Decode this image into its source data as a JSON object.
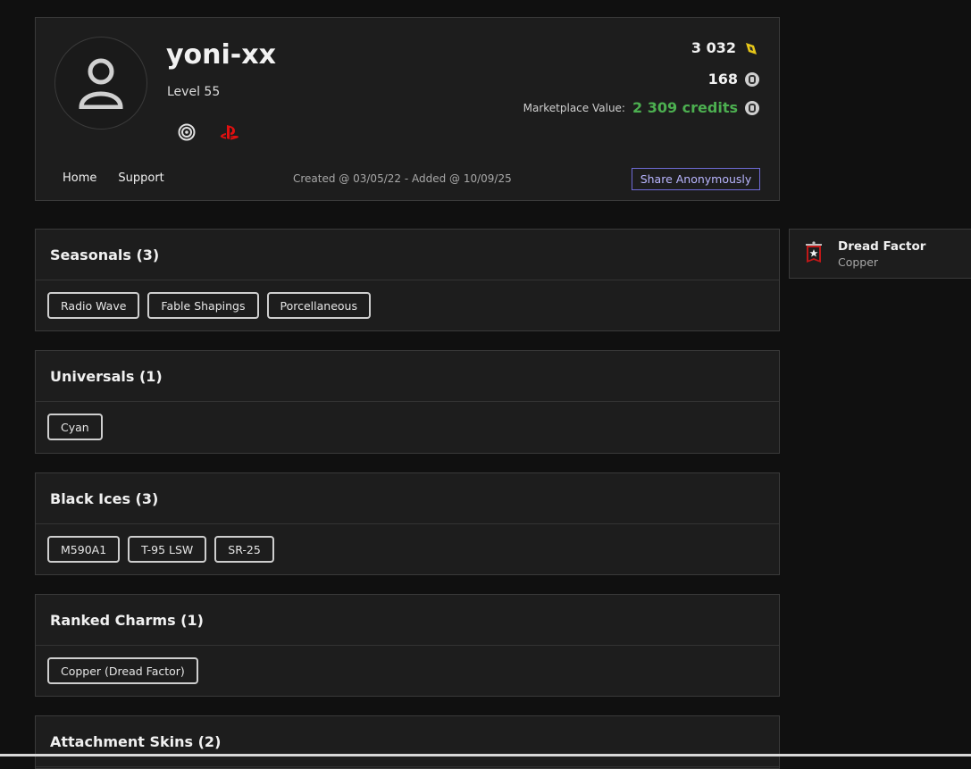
{
  "profile": {
    "username": "yoni-xx",
    "level": "Level 55",
    "renown": "3 032",
    "credits": "168",
    "marketplace_label": "Marketplace Value:",
    "marketplace_value": "2 309 credits",
    "platforms": [
      "ubisoft-icon",
      "playstation-icon"
    ],
    "nav": {
      "home": "Home",
      "support": "Support"
    },
    "created": "Created @ 03/05/22 - Added @ 10/09/25",
    "share_label": "Share Anonymously"
  },
  "sections": [
    {
      "title": "Seasonals (3)",
      "items": [
        "Radio Wave",
        "Fable Shapings",
        "Porcellaneous"
      ]
    },
    {
      "title": "Universals (1)",
      "items": [
        "Cyan"
      ]
    },
    {
      "title": "Black Ices (3)",
      "items": [
        "M590A1",
        "T-95 LSW",
        "SR-25"
      ]
    },
    {
      "title": "Ranked Charms (1)",
      "items": [
        "Copper (Dread Factor)"
      ]
    },
    {
      "title": "Attachment Skins (2)",
      "items": []
    }
  ],
  "rank_card": {
    "name": "Dread Factor",
    "tier": "Copper"
  },
  "colors": {
    "accent": "#6f6bd6",
    "value_green": "#4caf50",
    "background": "#101010",
    "panel": "#1d1d1d"
  }
}
